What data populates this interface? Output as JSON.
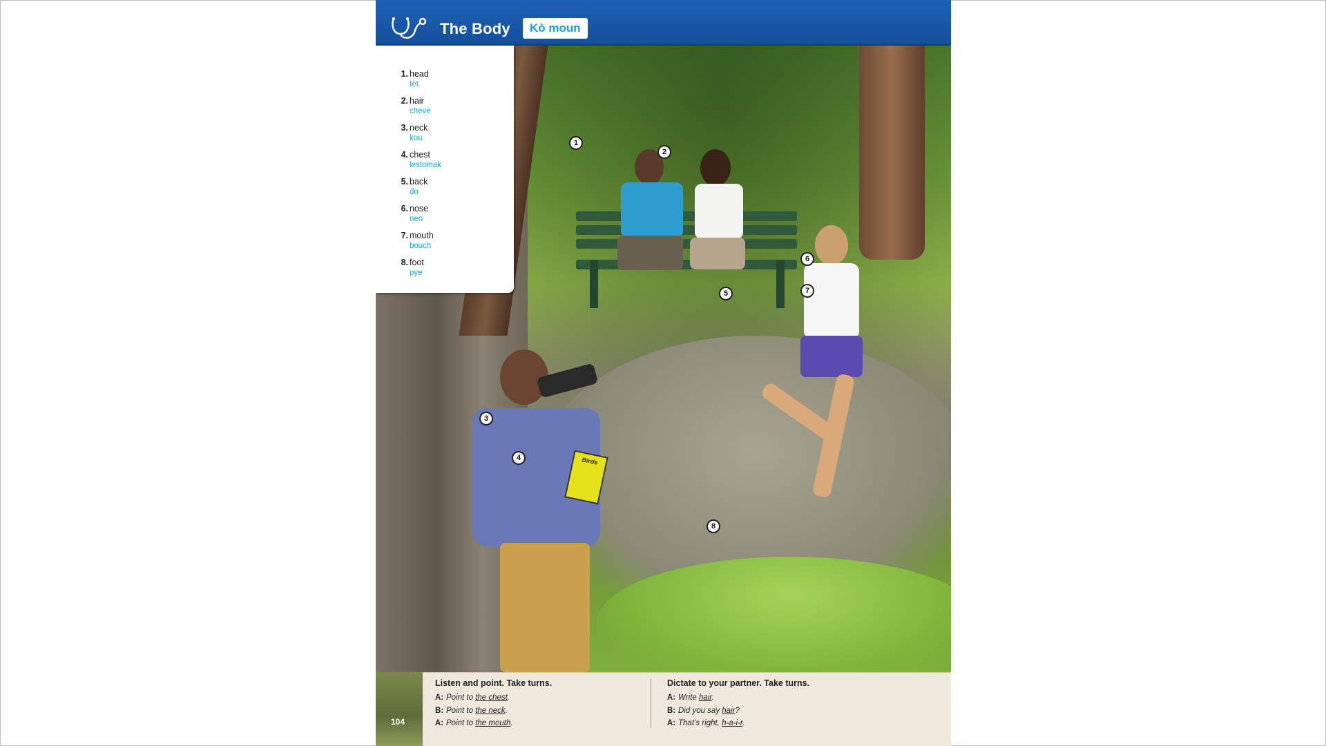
{
  "header": {
    "title_en": "The Body",
    "title_ht": "Kò moun",
    "icon": "stethoscope-icon",
    "colors": {
      "header_blue": "#1d62b6",
      "translation_blue": "#1ba3e4"
    }
  },
  "vocabulary": [
    {
      "num": "1.",
      "en": "head",
      "ht": "tèt"
    },
    {
      "num": "2.",
      "en": "hair",
      "ht": "cheve"
    },
    {
      "num": "3.",
      "en": "neck",
      "ht": "kou"
    },
    {
      "num": "4.",
      "en": "chest",
      "ht": "lestomak"
    },
    {
      "num": "5.",
      "en": "back",
      "ht": "do"
    },
    {
      "num": "6.",
      "en": "nose",
      "ht": "nen"
    },
    {
      "num": "7.",
      "en": "mouth",
      "ht": "bouch"
    },
    {
      "num": "8.",
      "en": "foot",
      "ht": "pye"
    }
  ],
  "markers": [
    "1",
    "2",
    "3",
    "4",
    "5",
    "6",
    "7",
    "8"
  ],
  "book_label": "Birds",
  "exercises": {
    "left": {
      "title": "Listen and point. Take turns.",
      "lines": [
        {
          "speaker": "A:",
          "pre": "Point to ",
          "ul": "the chest",
          "post": "."
        },
        {
          "speaker": "B:",
          "pre": "Point to ",
          "ul": "the neck",
          "post": "."
        },
        {
          "speaker": "A:",
          "pre": "Point to ",
          "ul": "the mouth",
          "post": "."
        }
      ]
    },
    "right": {
      "title": "Dictate to your partner. Take turns.",
      "lines": [
        {
          "speaker": "A:",
          "pre": "Write ",
          "ul": "hair",
          "post": "."
        },
        {
          "speaker": "B:",
          "pre": "Did you say ",
          "ul": "hair",
          "post": "?"
        },
        {
          "speaker": "A:",
          "pre": "That’s right, ",
          "ul": "h-a-i-r",
          "post": "."
        }
      ]
    }
  },
  "page_number": "104"
}
